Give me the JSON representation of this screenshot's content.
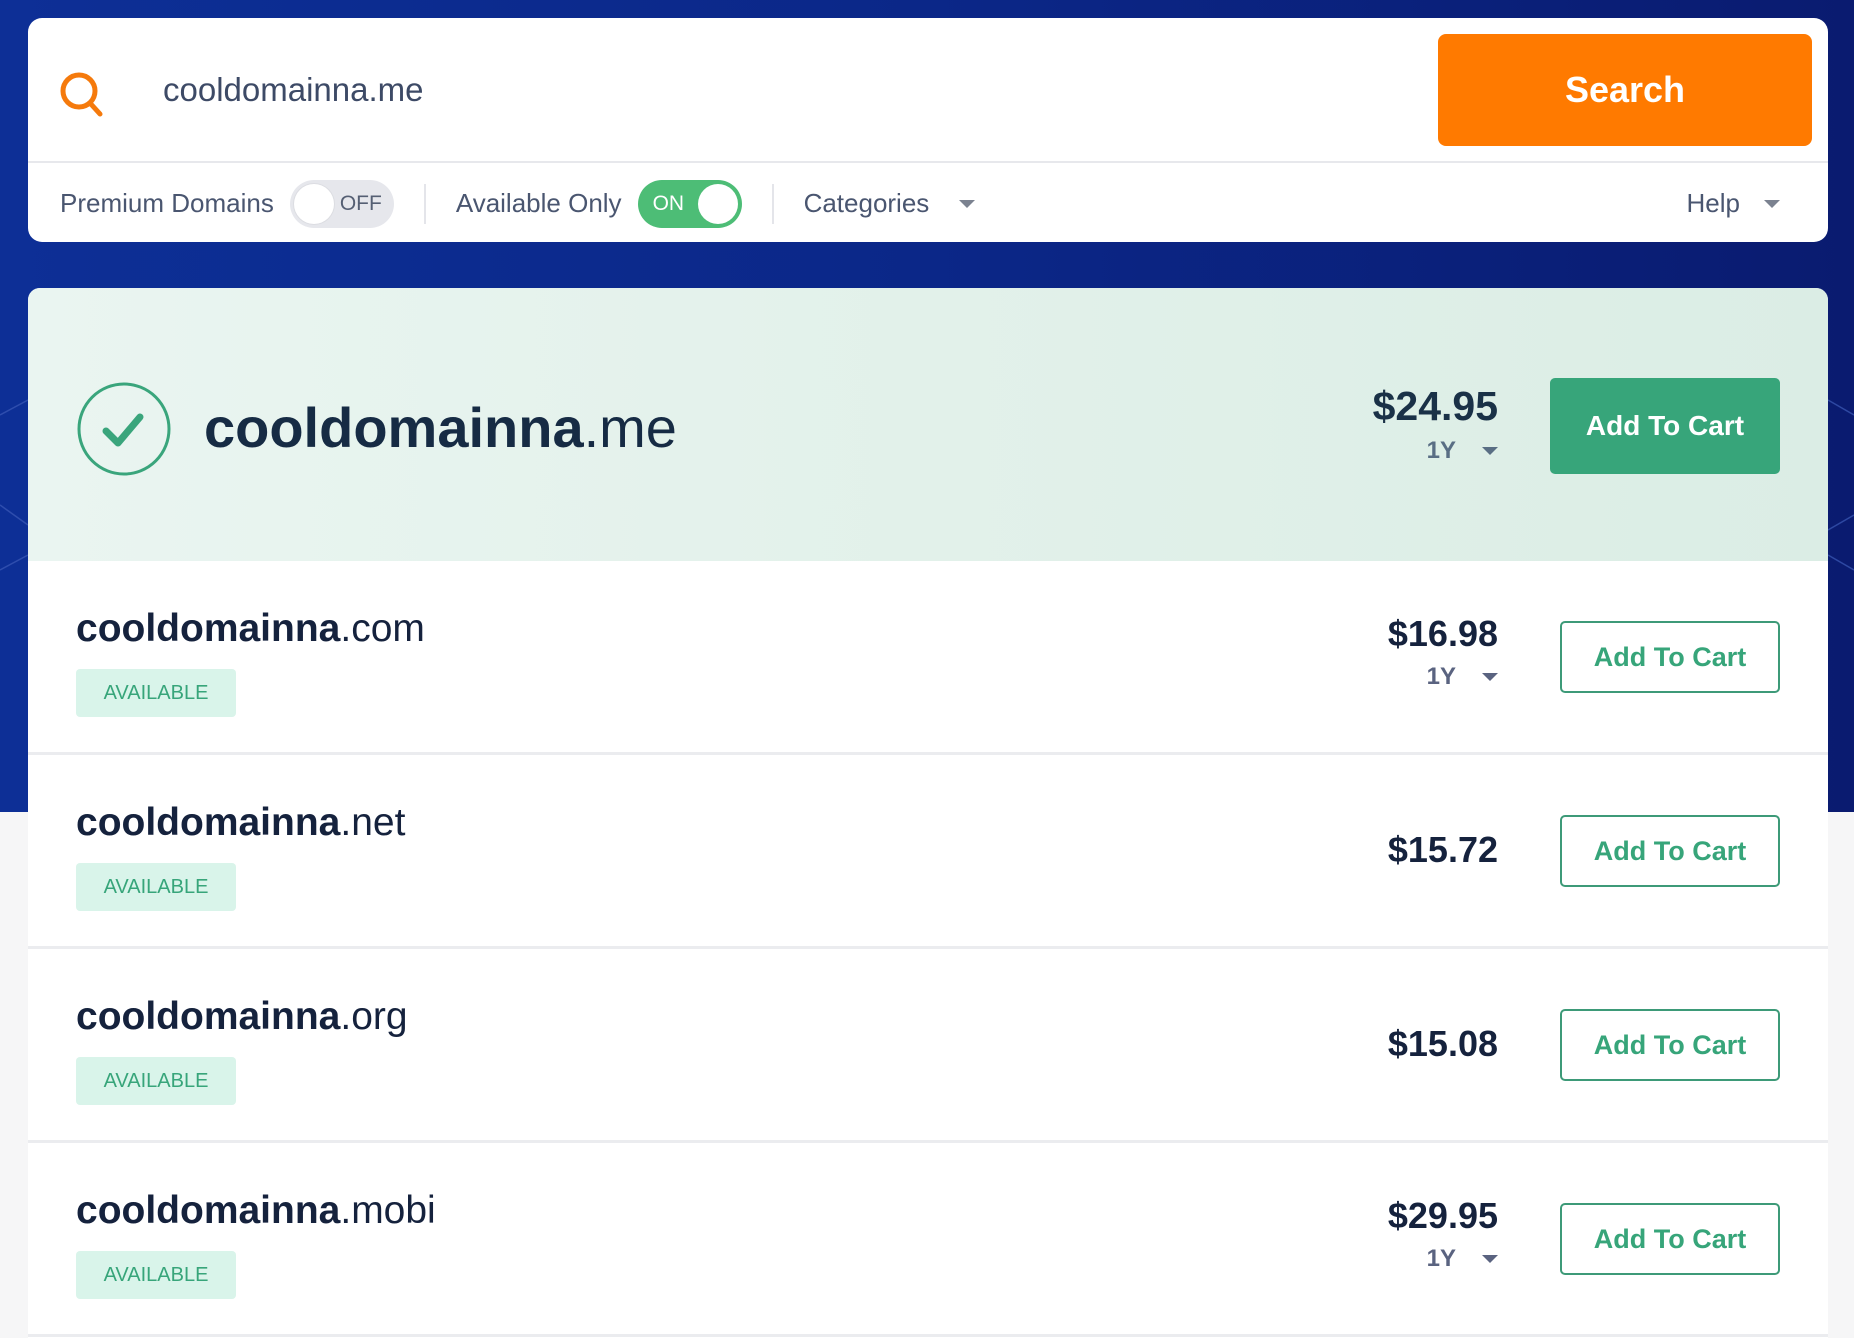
{
  "search": {
    "query": "cooldomainna.me",
    "button_label": "Search",
    "icon": "search-icon"
  },
  "filters": {
    "premium_label": "Premium Domains",
    "premium_state": "OFF",
    "available_label": "Available Only",
    "available_state": "ON",
    "categories_label": "Categories",
    "help_label": "Help"
  },
  "featured": {
    "sld": "cooldomainna",
    "tld": ".me",
    "price": "$24.95",
    "term": "1Y",
    "button_label": "Add To Cart",
    "status_icon": "check-circle-icon"
  },
  "results": [
    {
      "sld": "cooldomainna",
      "tld": ".com",
      "status": "AVAILABLE",
      "price": "$16.98",
      "term": "1Y",
      "button_label": "Add To Cart"
    },
    {
      "sld": "cooldomainna",
      "tld": ".net",
      "status": "AVAILABLE",
      "price": "$15.72",
      "term": null,
      "button_label": "Add To Cart"
    },
    {
      "sld": "cooldomainna",
      "tld": ".org",
      "status": "AVAILABLE",
      "price": "$15.08",
      "term": null,
      "button_label": "Add To Cart"
    },
    {
      "sld": "cooldomainna",
      "tld": ".mobi",
      "status": "AVAILABLE",
      "price": "$29.95",
      "term": "1Y",
      "button_label": "Add To Cart"
    }
  ],
  "colors": {
    "brand_blue": "#0b2788",
    "search_orange": "#ff7a00",
    "success_green": "#37a57a",
    "toggle_on": "#4dbd76"
  }
}
